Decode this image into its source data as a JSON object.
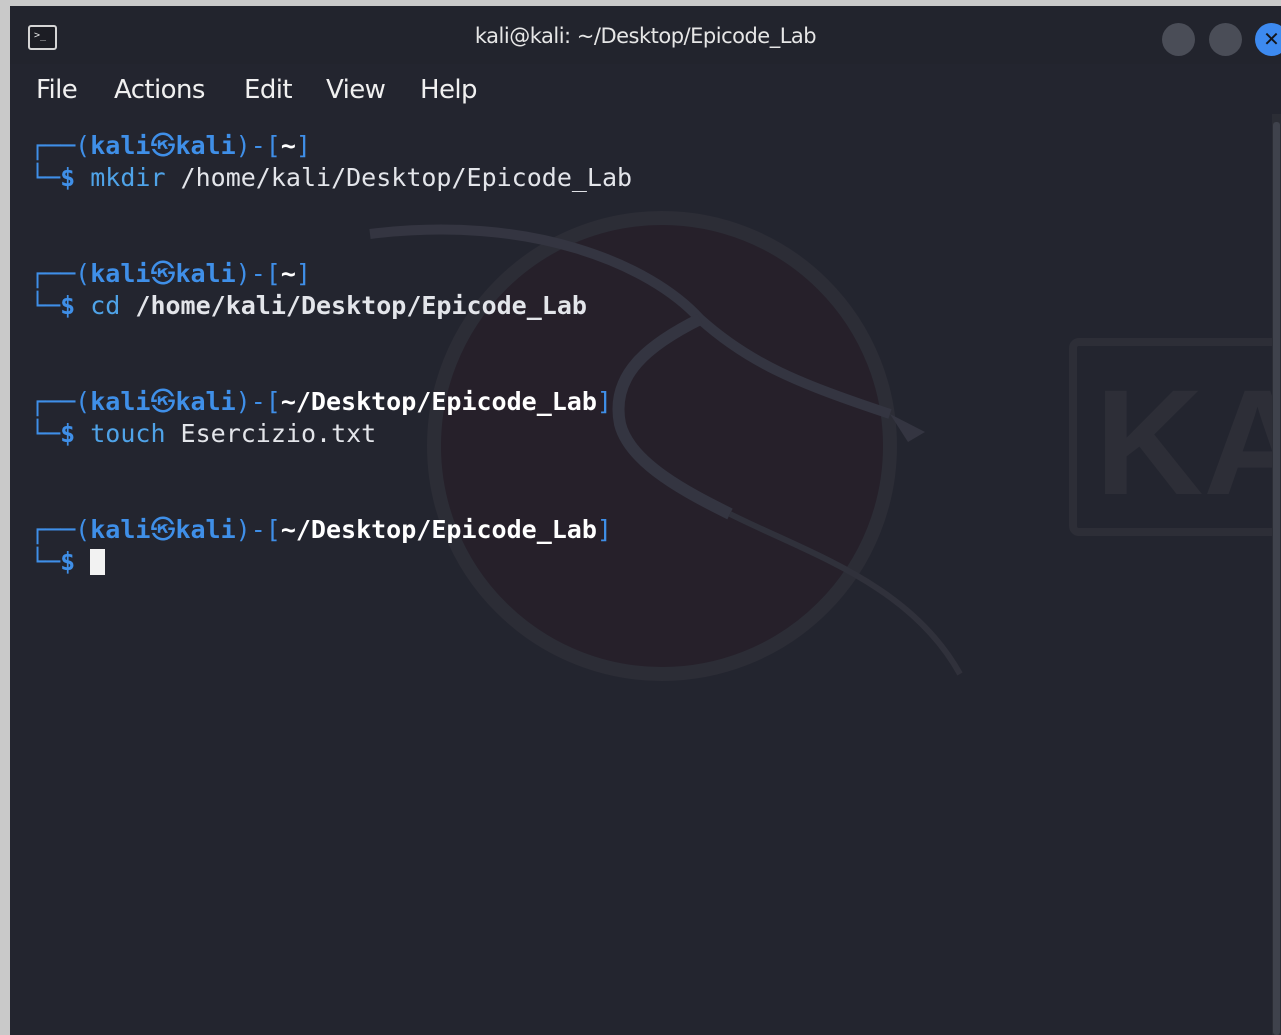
{
  "window": {
    "title": "kali@kali: ~/Desktop/Epicode_Lab",
    "app_icon": "terminal-icon",
    "app_icon_glyph": ">_",
    "close_glyph": "✕"
  },
  "menu": {
    "items": [
      "File",
      "Actions",
      "Edit",
      "View",
      "Help"
    ]
  },
  "terminal": {
    "entries": [
      {
        "user": "kali",
        "at_glyph": "㉿",
        "host": "kali",
        "dir": "~",
        "command": "mkdir",
        "argument": " /home/kali/Desktop/Epicode_Lab"
      },
      {
        "user": "kali",
        "at_glyph": "㉿",
        "host": "kali",
        "dir": "~",
        "command": "cd",
        "argument": " /home/kali/Desktop/Epicode_Lab"
      },
      {
        "user": "kali",
        "at_glyph": "㉿",
        "host": "kali",
        "dir": "~/Desktop/Epicode_Lab",
        "command": "touch",
        "argument": " Esercizio.txt"
      },
      {
        "user": "kali",
        "at_glyph": "㉿",
        "host": "kali",
        "dir": "~/Desktop/Epicode_Lab",
        "command": "",
        "argument": ""
      }
    ],
    "prompt_symbol": "$"
  },
  "colors": {
    "background": "#23252f",
    "prompt_blue": "#3f8fe8",
    "close_button": "#3d8af0"
  },
  "watermark": {
    "text": "KALI"
  }
}
